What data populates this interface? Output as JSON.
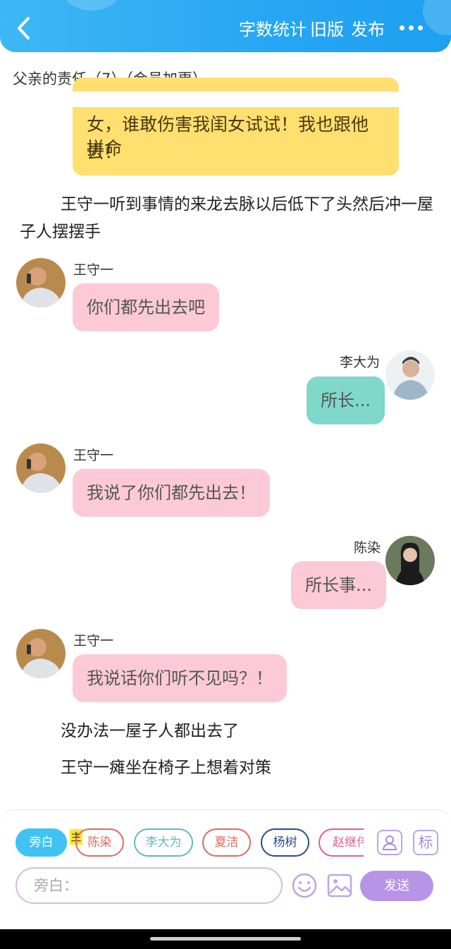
{
  "header": {
    "word_count_label": "字数统计",
    "old_version_label": "旧版",
    "publish_label": "发布",
    "brand_color": "#27a6f3"
  },
  "chapter_title": "父亲的责任（7）（会员加更）",
  "content": {
    "narration_bubble_lines": [
      "女，谁敢伤害我闺女试试！我也跟他拼命",
      "去！"
    ],
    "para1_line1": "王守一听到事情的来龙去脉以后低下了头然后冲一屋",
    "para1_line2": "子人摆摆手",
    "messages": [
      {
        "speaker": "王守一",
        "text": "你们都先出去吧"
      },
      {
        "speaker": "李大为",
        "text": "所长..."
      },
      {
        "speaker": "王守一",
        "text": "我说了你们都先出去！"
      },
      {
        "speaker": "陈染",
        "text": "所长事..."
      },
      {
        "speaker": "王守一",
        "text": "我说话你们听不见吗？！"
      }
    ],
    "para2": "没办法一屋子人都出去了",
    "para3": "王守一瘫坐在椅子上想着对策"
  },
  "composer": {
    "chips": [
      "旁白",
      "陈染",
      "李大为",
      "夏洁",
      "杨树",
      "赵继伟"
    ],
    "lead_badge": "主",
    "mark_label": "标",
    "input_placeholder": "旁白：",
    "send_label": "发送",
    "accent_color": "#b794e8"
  }
}
